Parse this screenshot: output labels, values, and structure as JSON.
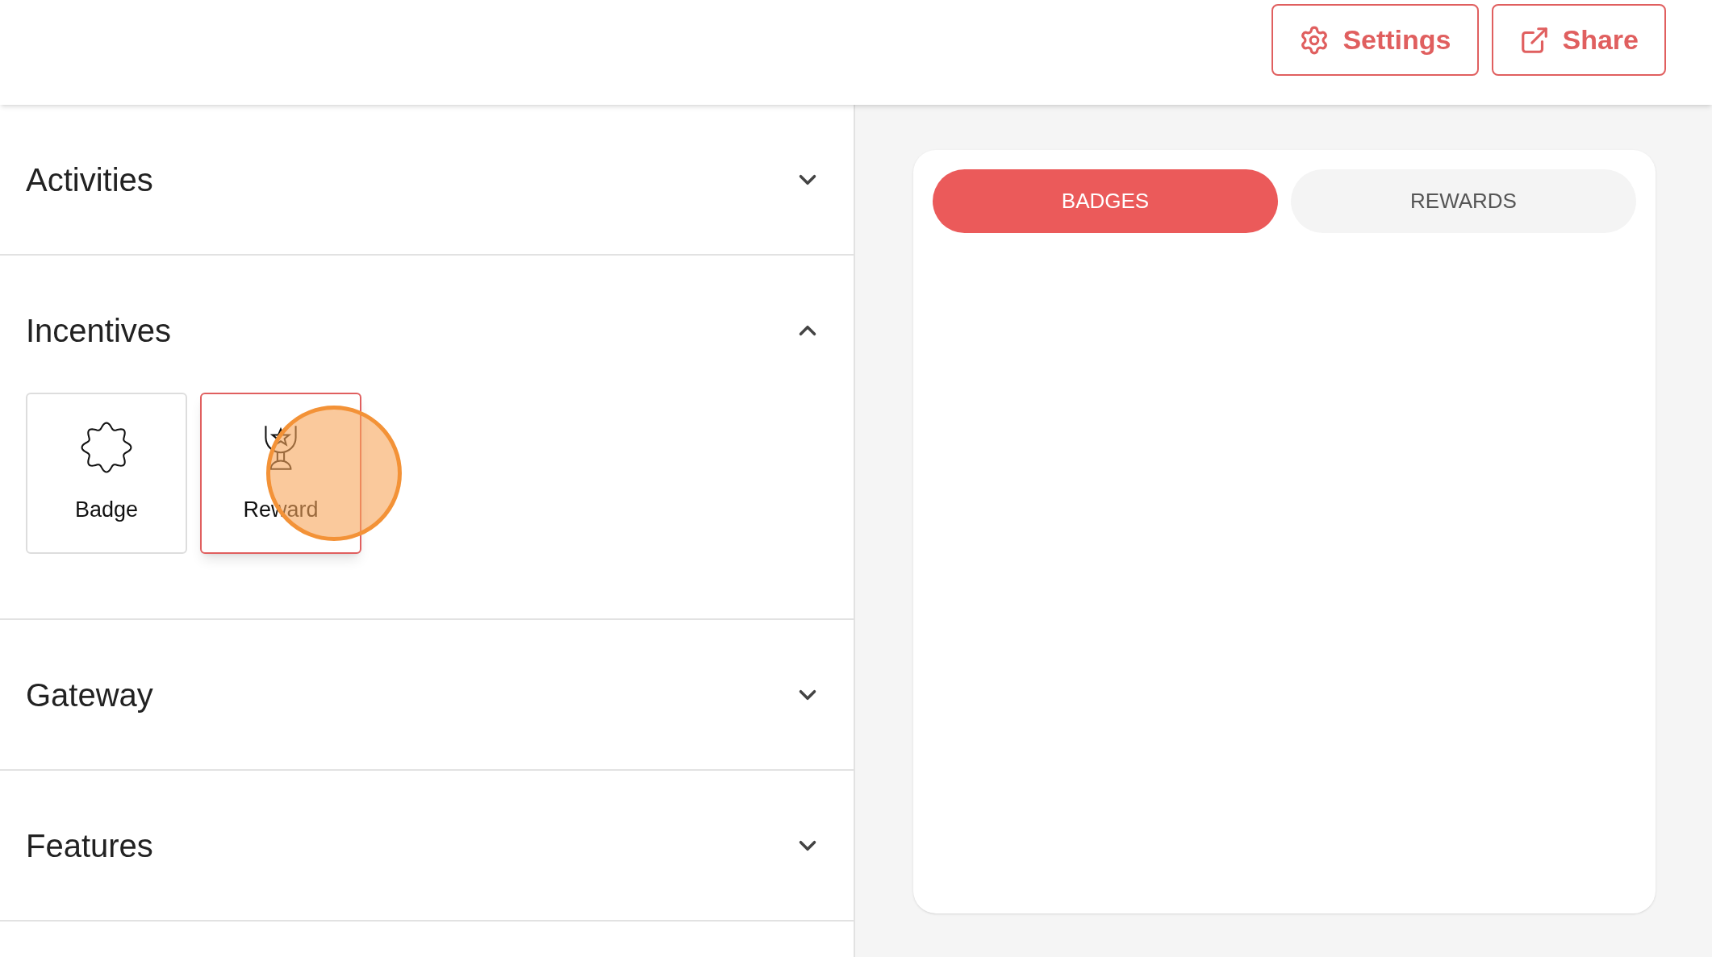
{
  "header": {
    "buttons": [
      {
        "label": "Settings",
        "kind": "settings"
      },
      {
        "label": "Share",
        "kind": "share"
      }
    ]
  },
  "sections": [
    {
      "title": "Activities",
      "expanded": false
    },
    {
      "title": "Incentives",
      "expanded": true,
      "items": [
        {
          "label": "Badge",
          "kind": "badge",
          "selected": false
        },
        {
          "label": "Reward",
          "kind": "reward",
          "selected": true
        }
      ]
    },
    {
      "title": "Gateway",
      "expanded": false
    },
    {
      "title": "Features",
      "expanded": false
    }
  ],
  "preview": {
    "tabs": [
      {
        "label": "BADGES",
        "selected": true
      },
      {
        "label": "REWARDS",
        "selected": false
      }
    ]
  }
}
